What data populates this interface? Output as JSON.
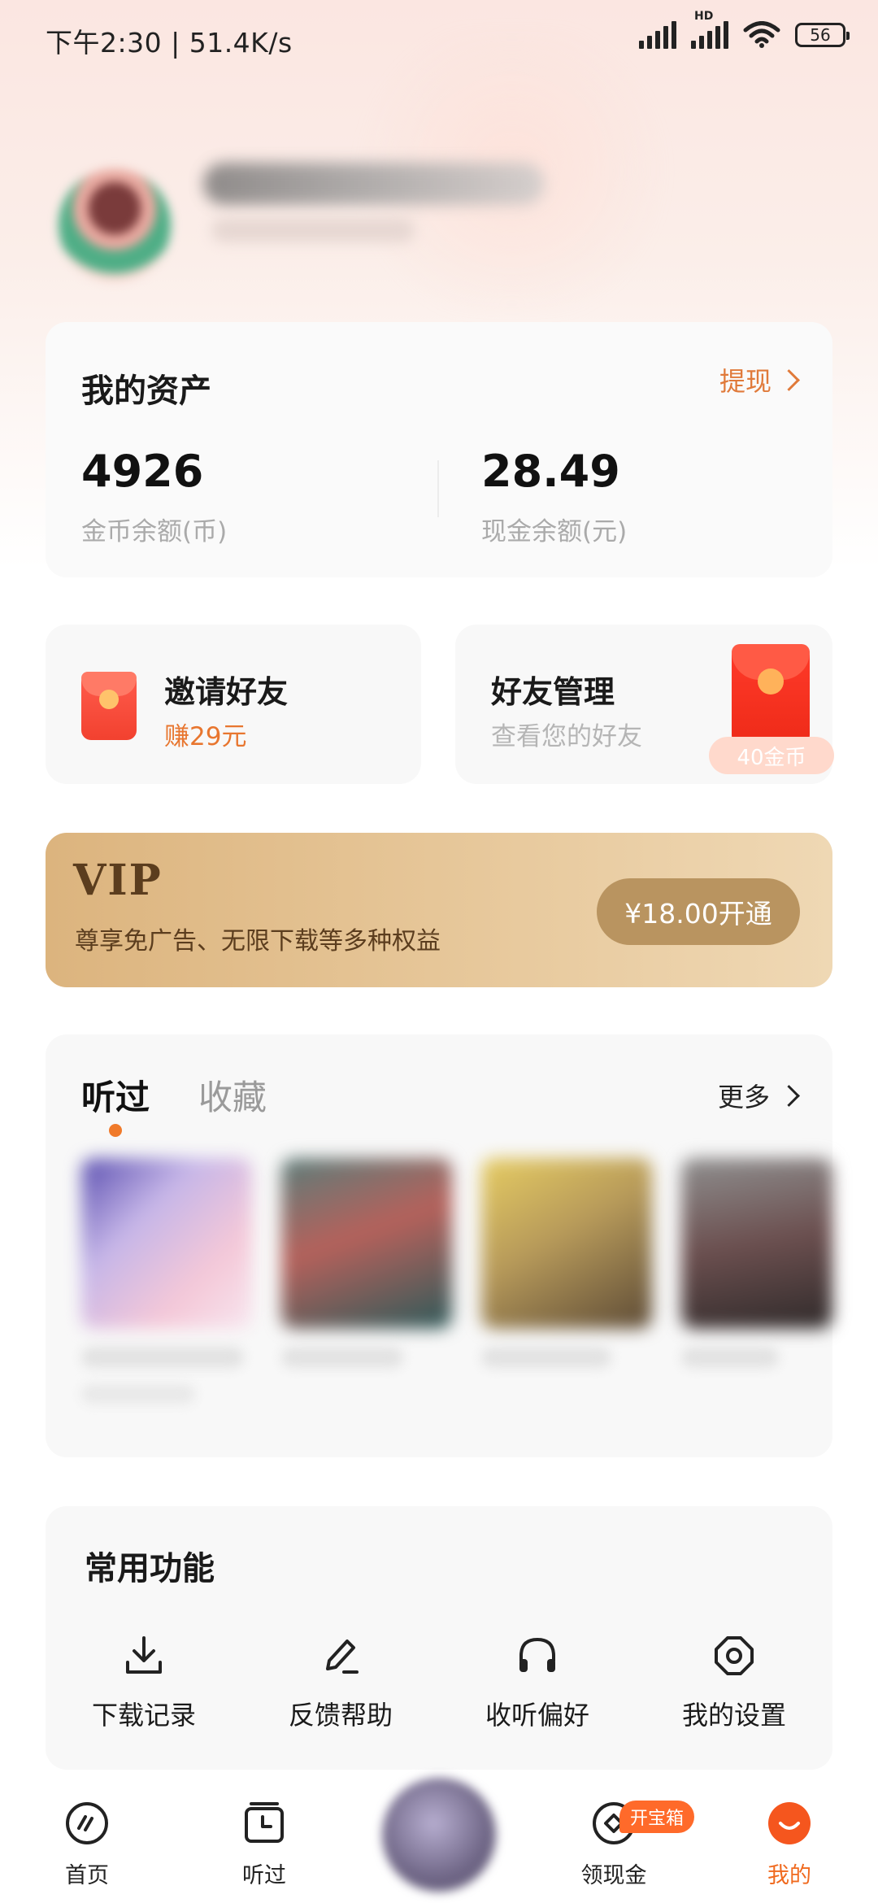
{
  "status_bar": {
    "time_speed": "下午2:30 | 51.4K/s",
    "network_label": "HD",
    "battery": "56"
  },
  "assets": {
    "title": "我的资产",
    "withdraw_label": "提现",
    "coin_value": "4926",
    "coin_label": "金币余额(币)",
    "cash_value": "28.49",
    "cash_label": "现金余额(元)"
  },
  "invite": {
    "title": "邀请好友",
    "reward": "赚29元"
  },
  "friends": {
    "title": "好友管理",
    "subtitle": "查看您的好友",
    "coin_badge": "40金币"
  },
  "vip": {
    "logo": "VIP",
    "description": "尊享免广告、无限下载等多种权益",
    "button_label": "¥18.00开通"
  },
  "history": {
    "tabs": [
      "听过",
      "收藏"
    ],
    "active_tab": 0,
    "more_label": "更多"
  },
  "functions": {
    "title": "常用功能",
    "items": [
      {
        "label": "下载记录",
        "icon": "download-icon"
      },
      {
        "label": "反馈帮助",
        "icon": "edit-icon"
      },
      {
        "label": "收听偏好",
        "icon": "headphones-icon"
      },
      {
        "label": "我的设置",
        "icon": "settings-icon"
      }
    ]
  },
  "bottom_nav": {
    "items": [
      {
        "label": "首页",
        "icon": "home-icon"
      },
      {
        "label": "听过",
        "icon": "history-icon"
      },
      {
        "label": "领现金",
        "icon": "cash-icon",
        "badge": "开宝箱"
      },
      {
        "label": "我的",
        "icon": "profile-icon",
        "active": true
      }
    ]
  },
  "colors": {
    "accent_orange": "#f06a1f",
    "vip_gold": "#dcb47e",
    "red_packet": "#f2412f"
  }
}
